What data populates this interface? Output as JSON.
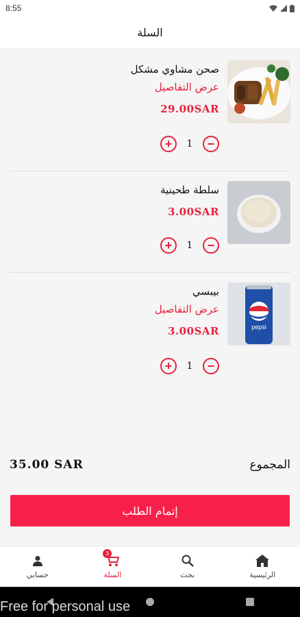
{
  "status": {
    "time": "8:55"
  },
  "header": {
    "title": "السلة"
  },
  "cart": {
    "items": [
      {
        "name": "صحن مشاوي مشكل",
        "details": "عرض التفاصيل",
        "price": "29.00SAR",
        "qty": "1"
      },
      {
        "name": "سلطة طحينية",
        "details": "",
        "price": "3.00SAR",
        "qty": "1"
      },
      {
        "name": "بيبسي",
        "details": "عرض التفاصيل",
        "price": "3.00SAR",
        "qty": "1"
      }
    ],
    "plus": "+",
    "minus": "−",
    "pepsi_logo_text": "pepsi"
  },
  "total": {
    "label": "المجموع",
    "value": "35.00 SAR"
  },
  "checkout": {
    "label": "إتمام الطلب"
  },
  "nav": {
    "account": "حسابي",
    "cart": "السلة",
    "cart_badge": "3",
    "search": "بحث",
    "home": "الرئيسية"
  },
  "watermark": "Free for personal use",
  "colors": {
    "accent": "#e8203c",
    "button": "#f7204a"
  }
}
